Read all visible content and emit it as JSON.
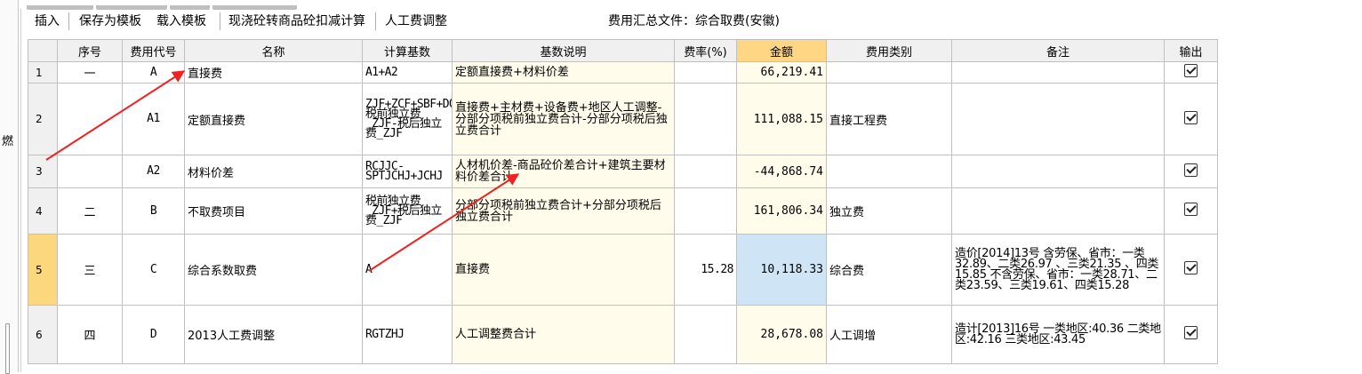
{
  "left_panel": {
    "partial_char": "燃"
  },
  "toolbar": {
    "insert_label": "插入",
    "save_template_label": "保存为模板",
    "load_template_label": "载入模板",
    "concrete_calc_label": "现浇砼转商品砼扣减计算",
    "labor_adjust_label": "人工费调整",
    "summary_file_label": "费用汇总文件：综合取费(安徽)"
  },
  "table": {
    "headers": {
      "seq": "序号",
      "code": "费用代号",
      "name": "名称",
      "base": "计算基数",
      "base_desc": "基数说明",
      "rate": "费率(%)",
      "amount": "金额",
      "category": "费用类别",
      "remark": "备注",
      "output": "输出"
    },
    "rows": [
      {
        "idx": "1",
        "seq": "一",
        "code": "A",
        "name": "直接费",
        "base": "A1+A2",
        "base_desc": "定额直接费+材料价差",
        "rate": "",
        "amount": "66,219.41",
        "category": "",
        "remark": "",
        "output": true
      },
      {
        "idx": "2",
        "seq": "",
        "code": "A1",
        "name": "定额直接费",
        "base": "ZJF+ZCF+SBF+DQRGTZ-税前独立费_ZJF-税后独立费_ZJF",
        "base_desc": "直接费+主材费+设备费+地区人工调整-分部分项税前独立费合计-分部分项税后独立费合计",
        "rate": "",
        "amount": "111,088.15",
        "category": "直接工程费",
        "remark": "",
        "output": true
      },
      {
        "idx": "3",
        "seq": "",
        "code": "A2",
        "name": "材料价差",
        "base": "RCJJC-SPTJCHJ+JCHJ",
        "base_desc": "人材机价差-商品砼价差合计+建筑主要材料价差合计",
        "rate": "",
        "amount": "-44,868.74",
        "category": "",
        "remark": "",
        "output": true
      },
      {
        "idx": "4",
        "seq": "二",
        "code": "B",
        "name": "不取费项目",
        "base": "税前独立费_ZJF+税后独立费_ZJF",
        "base_desc": "分部分项税前独立费合计+分部分项税后独立费合计",
        "rate": "",
        "amount": "161,806.34",
        "category": "独立费",
        "remark": "",
        "output": true
      },
      {
        "idx": "5",
        "seq": "三",
        "code": "C",
        "name": "综合系数取费",
        "base": "A",
        "base_desc": "直接费",
        "rate": "15.28",
        "amount": "10,118.33",
        "category": "综合费",
        "remark": "造价[2014]13号 含劳保、省市：一类32.89、二类26.97 、三类21.35 、四类15.85 不含劳保、省市：一类28.71、二类23.59、三类19.61、四类15.28",
        "output": true
      },
      {
        "idx": "6",
        "seq": "四",
        "code": "D",
        "name": "2013人工费调整",
        "base": "RGTZHJ",
        "base_desc": "人工调整费合计",
        "rate": "",
        "amount": "28,678.08",
        "category": "人工调增",
        "remark": "造计[2013]16号 一类地区:40.36 二类地区:42.16 三类地区:43.45",
        "output": true
      }
    ]
  },
  "colors": {
    "amount_header": "#ffd684",
    "selected_row_index": "#fbd77e",
    "selected_amount_cell": "#cfe5f5",
    "annotation_arrow": "#ee2222"
  }
}
